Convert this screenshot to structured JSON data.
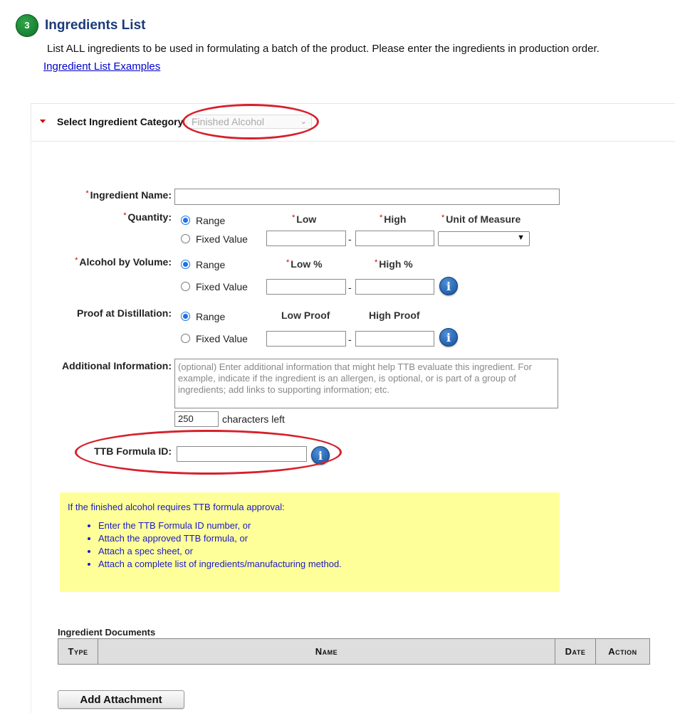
{
  "section": {
    "step": "3",
    "title": "Ingredients List",
    "intro": "List ALL ingredients to be used in formulating a batch of the product. Please enter the ingredients in production order.",
    "examples_link": "Ingredient List Examples"
  },
  "category": {
    "label": "Select Ingredient Category",
    "selected": "Finished Alcohol"
  },
  "form": {
    "required_mark": "*",
    "ingredient_name": {
      "label": "Ingredient Name:",
      "value": ""
    },
    "quantity": {
      "label": "Quantity:",
      "range": "Range",
      "fixed": "Fixed Value",
      "low": "Low",
      "high": "High",
      "unit": "Unit of Measure",
      "dash": "-",
      "selected_mode": "Range"
    },
    "abv": {
      "label": "Alcohol by Volume:",
      "range": "Range",
      "fixed": "Fixed Value",
      "low": "Low %",
      "high": "High %",
      "dash": "-",
      "selected_mode": "Range"
    },
    "proof": {
      "label": "Proof at Distillation:",
      "range": "Range",
      "fixed": "Fixed Value",
      "low": "Low Proof",
      "high": "High Proof",
      "dash": "-",
      "selected_mode": "Range"
    },
    "additional": {
      "label": "Additional Information:",
      "placeholder": "(optional) Enter additional information that might help TTB evaluate this ingredient. For example, indicate if the ingredient is an allergen, is optional, or is part of a group of ingredients; add links to supporting information; etc.",
      "chars_left": "250",
      "chars_left_label": "characters left"
    },
    "formula_id": {
      "label": "TTB Formula ID:",
      "value": ""
    },
    "info_glyph": "i"
  },
  "note": {
    "intro": "If the finished alcohol requires TTB formula approval:",
    "items": [
      "Enter the TTB Formula ID number, or",
      "Attach the approved TTB formula, or",
      "Attach a spec sheet, or",
      "Attach a complete list of ingredients/manufacturing method."
    ]
  },
  "documents": {
    "label": "Ingredient Documents",
    "columns": [
      "Type",
      "Name",
      "Date",
      "Action"
    ],
    "add_button": "Add Attachment"
  },
  "colors": {
    "title": "#1b3a7a",
    "link": "#0000cc",
    "required": "#cc0000",
    "note_bg": "#ffff99",
    "note_text": "#1a1ac8",
    "annotation": "#d6202b",
    "step_circle": "#13822f"
  }
}
